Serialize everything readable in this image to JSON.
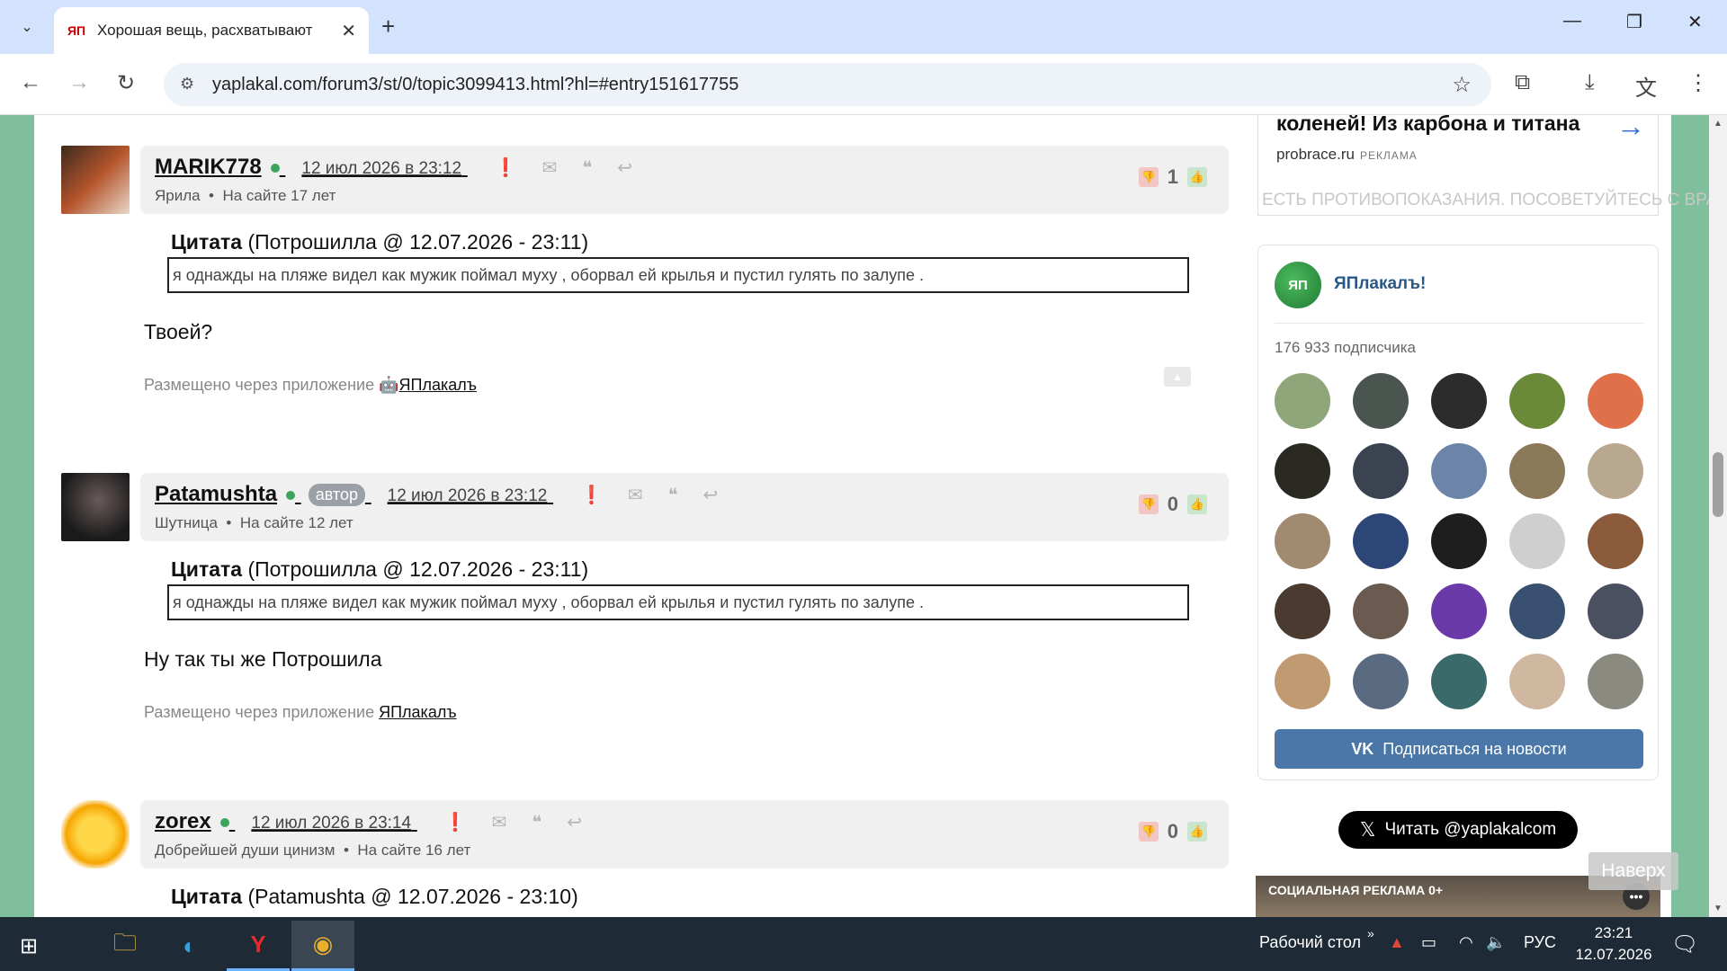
{
  "browser": {
    "tab_title": "Хорошая вещь, расхватывают",
    "tab_favicon": "ЯП",
    "url": "yaplakal.com/forum3/st/0/topic3099413.html?hl=#entry151617755"
  },
  "posts": [
    {
      "username": "MARIK778",
      "author_badge": "",
      "date": "12 июл 2026 в 23:12",
      "subtitle": "Ярила",
      "site_age": "На сайте 17 лет",
      "rating": "1",
      "quote_title_bold": "Цитата",
      "quote_title_rest": " (Потрошилла @ 12.07.2026 - 23:11)",
      "quote_text": "я однажды на пляже видел как мужик поймал муху , оборвал ей крылья и пустил гулять по залупе .",
      "text": "Твоей?",
      "via": "Размещено через приложение",
      "via_app": "ЯПлакалъ",
      "via_icon": "android-icon"
    },
    {
      "username": "Patamushta",
      "author_badge": "автор",
      "date": "12 июл 2026 в 23:12",
      "subtitle": "Шутница",
      "site_age": "На сайте 12 лет",
      "rating": "0",
      "quote_title_bold": "Цитата",
      "quote_title_rest": " (Потрошилла @ 12.07.2026 - 23:11)",
      "quote_text": "я однажды на пляже видел как мужик поймал муху , оборвал ей крылья и пустил гулять по залупе .",
      "text": "Ну так ты же Потрошила",
      "via": "Размещено через приложение",
      "via_app": "ЯПлакалъ",
      "via_icon": "apple-icon"
    },
    {
      "username": "zorex",
      "author_badge": "",
      "date": "12 июл 2026 в 23:14",
      "subtitle": "Добрейшей души цинизм",
      "site_age": "На сайте 16 лет",
      "rating": "0",
      "quote_title_bold": "Цитата",
      "quote_title_rest": " (Patamushta @ 12.07.2026 - 23:10)"
    }
  ],
  "sidebar": {
    "ad_headline": "коленей! Из карбона и титана",
    "ad_domain": "probrace.ru",
    "ad_label": "РЕКЛАМА",
    "ad_warning": "ЕСТЬ ПРОТИВОПОКАЗАНИЯ. ПОСОВЕТУЙТЕСЬ С ВРАЧОМ",
    "vk_logo": "ЯП",
    "vk_group": "ЯПлакалъ!",
    "vk_subscribers": "176 933 подписчика",
    "vk_subscribe": "Подписаться на новости",
    "x_follow": "Читать @yaplakalcom",
    "social_ad": "СОЦИАЛЬНАЯ РЕКЛАМА 0+"
  },
  "back_to_top": "Наверх",
  "taskbar": {
    "desktop_label": "Рабочий стол",
    "lang": "РУС",
    "time": "23:21",
    "date": "12.07.2026"
  },
  "colors": {
    "page_bg": "#7fbf9c",
    "online": "#3ba55c",
    "vk_button": "#4a76a8",
    "link_blue": "#2a5885"
  }
}
